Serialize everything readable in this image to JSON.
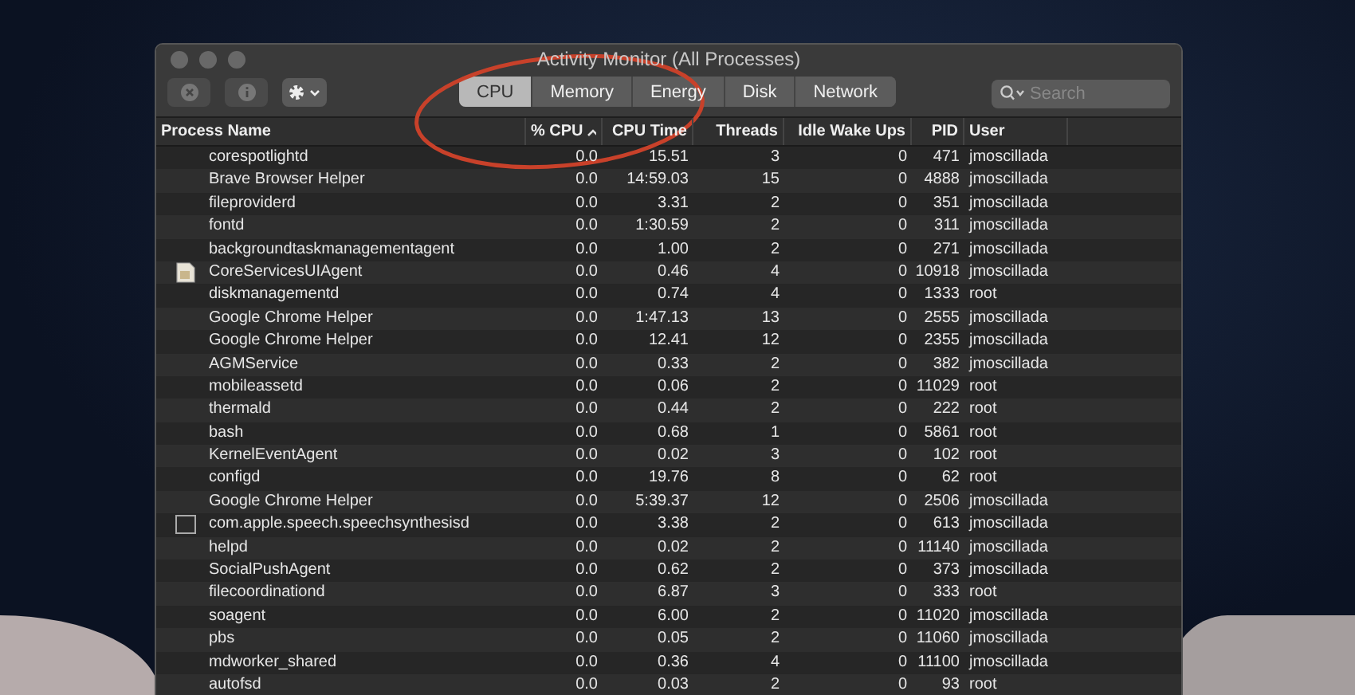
{
  "window": {
    "title": "Activity Monitor (All Processes)"
  },
  "toolbar": {
    "tabs": [
      {
        "label": "CPU",
        "selected": true
      },
      {
        "label": "Memory",
        "selected": false
      },
      {
        "label": "Energy",
        "selected": false
      },
      {
        "label": "Disk",
        "selected": false
      },
      {
        "label": "Network",
        "selected": false
      }
    ],
    "search": {
      "placeholder": "Search"
    }
  },
  "table": {
    "columns": [
      {
        "label": "Process Name",
        "sorted": false
      },
      {
        "label": "% CPU",
        "sorted": true
      },
      {
        "label": "CPU Time",
        "sorted": false
      },
      {
        "label": "Threads",
        "sorted": false
      },
      {
        "label": "Idle Wake Ups",
        "sorted": false
      },
      {
        "label": "PID",
        "sorted": false
      },
      {
        "label": "User",
        "sorted": false
      }
    ],
    "rows": [
      {
        "kind": "plain",
        "cells": [
          "corespotlightd",
          "0.0",
          "15.51",
          "3",
          "0",
          "471",
          "jmoscillada"
        ]
      },
      {
        "kind": "plain",
        "cells": [
          "Brave Browser Helper",
          "0.0",
          "14:59.03",
          "15",
          "0",
          "4888",
          "jmoscillada"
        ]
      },
      {
        "kind": "plain",
        "cells": [
          "fileproviderd",
          "0.0",
          "3.31",
          "2",
          "0",
          "351",
          "jmoscillada"
        ]
      },
      {
        "kind": "plain",
        "cells": [
          "fontd",
          "0.0",
          "1:30.59",
          "2",
          "0",
          "311",
          "jmoscillada"
        ]
      },
      {
        "kind": "plain",
        "cells": [
          "backgroundtaskmanagementagent",
          "0.0",
          "1.00",
          "2",
          "0",
          "271",
          "jmoscillada"
        ]
      },
      {
        "kind": "app",
        "cells": [
          "CoreServicesUIAgent",
          "0.0",
          "0.46",
          "4",
          "0",
          "10918",
          "jmoscillada"
        ]
      },
      {
        "kind": "plain",
        "cells": [
          "diskmanagementd",
          "0.0",
          "0.74",
          "4",
          "0",
          "1333",
          "root"
        ]
      },
      {
        "kind": "plain",
        "cells": [
          "Google Chrome Helper",
          "0.0",
          "1:47.13",
          "13",
          "0",
          "2555",
          "jmoscillada"
        ]
      },
      {
        "kind": "plain",
        "cells": [
          "Google Chrome Helper",
          "0.0",
          "12.41",
          "12",
          "0",
          "2355",
          "jmoscillada"
        ]
      },
      {
        "kind": "plain",
        "cells": [
          "AGMService",
          "0.0",
          "0.33",
          "2",
          "0",
          "382",
          "jmoscillada"
        ]
      },
      {
        "kind": "plain",
        "cells": [
          "mobileassetd",
          "0.0",
          "0.06",
          "2",
          "0",
          "11029",
          "root"
        ]
      },
      {
        "kind": "plain",
        "cells": [
          "thermald",
          "0.0",
          "0.44",
          "2",
          "0",
          "222",
          "root"
        ]
      },
      {
        "kind": "plain",
        "cells": [
          "bash",
          "0.0",
          "0.68",
          "1",
          "0",
          "5861",
          "root"
        ]
      },
      {
        "kind": "plain",
        "cells": [
          "KernelEventAgent",
          "0.0",
          "0.02",
          "3",
          "0",
          "102",
          "root"
        ]
      },
      {
        "kind": "plain",
        "cells": [
          "configd",
          "0.0",
          "19.76",
          "8",
          "0",
          "62",
          "root"
        ]
      },
      {
        "kind": "plain",
        "cells": [
          "Google Chrome Helper",
          "0.0",
          "5:39.37",
          "12",
          "0",
          "2506",
          "jmoscillada"
        ]
      },
      {
        "kind": "window",
        "cells": [
          "com.apple.speech.speechsynthesisd",
          "0.0",
          "3.38",
          "2",
          "0",
          "613",
          "jmoscillada"
        ]
      },
      {
        "kind": "plain",
        "cells": [
          "helpd",
          "0.0",
          "0.02",
          "2",
          "0",
          "11140",
          "jmoscillada"
        ]
      },
      {
        "kind": "plain",
        "cells": [
          "SocialPushAgent",
          "0.0",
          "0.62",
          "2",
          "0",
          "373",
          "jmoscillada"
        ]
      },
      {
        "kind": "plain",
        "cells": [
          "filecoordinationd",
          "0.0",
          "6.87",
          "3",
          "0",
          "333",
          "root"
        ]
      },
      {
        "kind": "plain",
        "cells": [
          "soagent",
          "0.0",
          "6.00",
          "2",
          "0",
          "11020",
          "jmoscillada"
        ]
      },
      {
        "kind": "plain",
        "cells": [
          "pbs",
          "0.0",
          "0.05",
          "2",
          "0",
          "11060",
          "jmoscillada"
        ]
      },
      {
        "kind": "plain",
        "cells": [
          "mdworker_shared",
          "0.0",
          "0.36",
          "4",
          "0",
          "11100",
          "jmoscillada"
        ]
      },
      {
        "kind": "plain",
        "cells": [
          "autofsd",
          "0.0",
          "0.03",
          "2",
          "0",
          "93",
          "root"
        ]
      }
    ]
  }
}
